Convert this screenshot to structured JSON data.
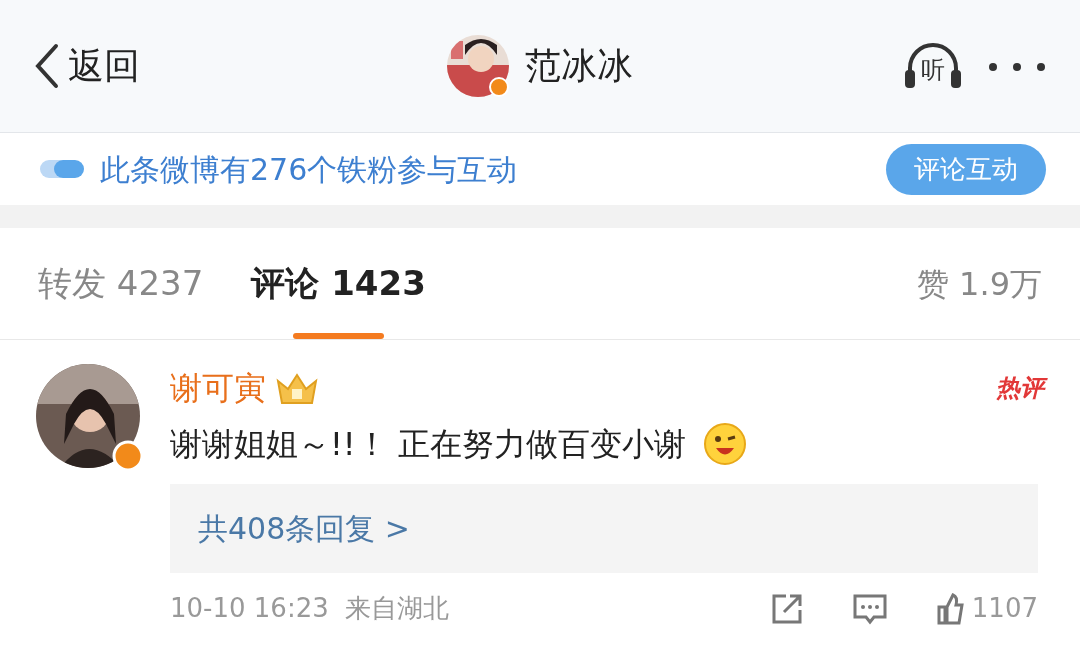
{
  "header": {
    "back_label": "返回",
    "title": "范冰冰",
    "listen_label": "听"
  },
  "banner": {
    "text": "此条微博有276个铁粉参与互动",
    "button": "评论互动"
  },
  "tabs": [
    {
      "label": "转发",
      "count": "4237",
      "selected": false
    },
    {
      "label": "评论",
      "count": "1423",
      "selected": true
    }
  ],
  "likes": {
    "label": "赞",
    "count": "1.9万"
  },
  "comment": {
    "author": "谢可寅",
    "badge": "热评",
    "text": "谢谢姐姐～!!！ 正在努力做百变小谢",
    "replies": "共408条回复 >",
    "time": "10-10 16:23",
    "source": "来自湖北",
    "like_count": "1107"
  }
}
